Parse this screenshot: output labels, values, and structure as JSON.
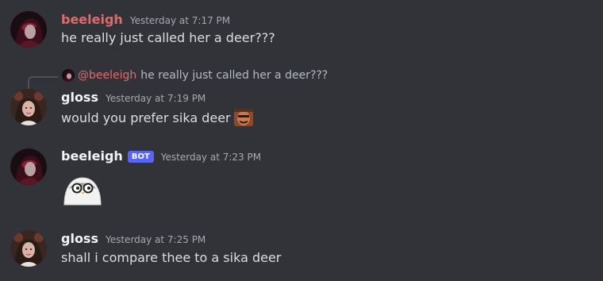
{
  "messages": [
    {
      "author": "beeleigh",
      "timestamp": "Yesterday at 7:17 PM",
      "text": "he really just called her a deer???"
    },
    {
      "reply": {
        "mention": "@beeleigh",
        "text": "he really just called her a deer???"
      },
      "author": "gloss",
      "timestamp": "Yesterday at 7:19 PM",
      "text": "would you prefer sika deer",
      "emoji": "man-face-emoji"
    },
    {
      "author": "beeleigh",
      "bot_tag": "BOT",
      "timestamp": "Yesterday at 7:23 PM",
      "sticker": "bird-sticker"
    },
    {
      "author": "gloss",
      "timestamp": "Yesterday at 7:25 PM",
      "text": "shall i compare thee to a sika deer"
    }
  ],
  "colors": {
    "background": "#313338",
    "beeleigh_name": "#e06b6b",
    "gloss_name": "#f2f3f5",
    "bot_tag": "#5865f2",
    "timestamp": "#a5a9b0"
  }
}
